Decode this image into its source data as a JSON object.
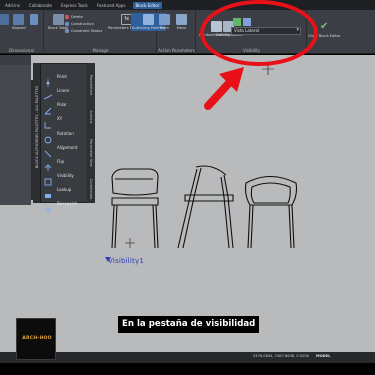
{
  "ribbon_tabs": [
    "Add-ins",
    "Collaborate",
    "Express Tools",
    "Featured Apps",
    "Block Editor"
  ],
  "active_tab_index": 4,
  "ribbon": {
    "dimensional_label": "Dimensional",
    "manage_label": "Manage",
    "action_params_label": "Action Parameters",
    "visibility_label": "Visibility",
    "alignment": "Aligned",
    "block_table": "Block Table",
    "delete": "Delete",
    "construction": "Construction",
    "constraint_status": "Constraint Status",
    "parameters_manager": "Parameters Manager",
    "authoring_palettes": "Authoring Palettes",
    "point": "Point",
    "move": "Move",
    "attribute_definition": "Attribute Definition",
    "visibility_states": "Visibility States",
    "visibility_dropdown": "Vista Lateral",
    "close_block_editor": "Close Block Editor"
  },
  "left_strip_text": "Ⅲ n_06_11_17",
  "palette_title": "BLOCK AUTHORING PALETTES - ALL PALETTES",
  "palette_tabs": [
    "Parameters",
    "Actions",
    "Parameter Sets",
    "Constraints"
  ],
  "palette_items": [
    "Point",
    "Linear",
    "Polar",
    "XY",
    "Rotation",
    "Alignment",
    "Flip",
    "Visibility",
    "Lookup",
    "Basepoint"
  ],
  "canvas_label": "Visibility1",
  "subtitle": "En la pestaña de visibilidad",
  "logo_text": "ARCH-HOO",
  "status_coords": "5376.0644, 1587.6638, 0.0000",
  "status_model": "MODEL",
  "colors": {
    "annotation": "#e8111a",
    "canvas_bg": "#b9babc",
    "ribbon_bg": "#3b3e44",
    "active_tab": "#2f5f9a",
    "logo": "#e2a73b"
  }
}
